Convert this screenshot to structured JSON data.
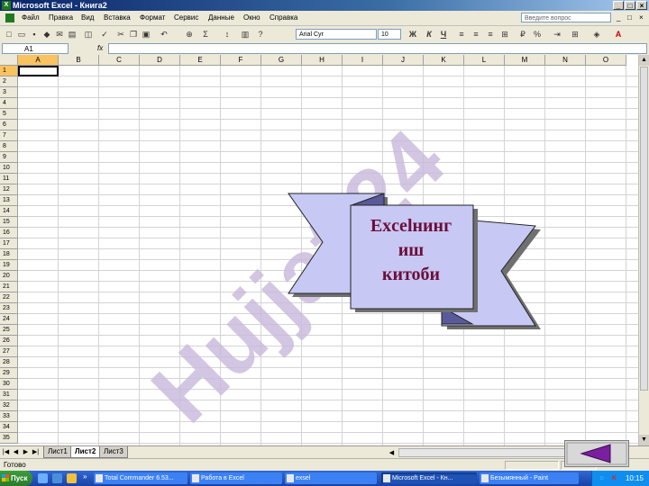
{
  "window": {
    "title": "Microsoft Excel - Книга2",
    "controls": [
      "_",
      "□",
      "×"
    ]
  },
  "menubar": {
    "items": [
      "Файл",
      "Правка",
      "Вид",
      "Вставка",
      "Формат",
      "Сервис",
      "Данные",
      "Окно",
      "Справка"
    ],
    "help_placeholder": "Введите вопрос",
    "doc_controls": [
      "_",
      "□",
      "×"
    ]
  },
  "toolbar": {
    "font": "Arial Cyr",
    "size": "10",
    "bold": "Ж",
    "italic": "К",
    "underline": "Ч",
    "sum": "Σ",
    "percent": "%",
    "zoom_icon": "magnifier-icon"
  },
  "formula_bar": {
    "name_box": "A1",
    "fx": "fx",
    "value": ""
  },
  "grid": {
    "columns": [
      "A",
      "B",
      "C",
      "D",
      "E",
      "F",
      "G",
      "H",
      "I",
      "J",
      "K",
      "L",
      "M",
      "N",
      "O"
    ],
    "rows": [
      "1",
      "2",
      "3",
      "4",
      "5",
      "6",
      "7",
      "8",
      "9",
      "10",
      "11",
      "12",
      "13",
      "14",
      "15",
      "16",
      "17",
      "18",
      "19",
      "20",
      "21",
      "22",
      "23",
      "24",
      "25",
      "26",
      "27",
      "28",
      "29",
      "30",
      "31",
      "32",
      "33",
      "34",
      "35"
    ],
    "selected_cell": "A1"
  },
  "sheets": {
    "tabs": [
      "Лист1",
      "Лист2",
      "Лист3"
    ],
    "active": "Лист2"
  },
  "status": {
    "text": "Готово"
  },
  "banner": {
    "line1": "Excelнинг",
    "line2": "иш",
    "line3": "китоби"
  },
  "watermark": {
    "text": "Hujjat 24"
  },
  "taskbar": {
    "start": "Пуск",
    "tasks": [
      {
        "label": "Total Commander 6.53...",
        "active": false
      },
      {
        "label": "Работа в Excel",
        "active": false
      },
      {
        "label": "exsel",
        "active": false
      },
      {
        "label": "Microsoft Excel - Кн...",
        "active": true
      },
      {
        "label": "Безымянный - Paint",
        "active": false
      }
    ],
    "clock": "10:15",
    "tray_letter": "K"
  },
  "nav_button": {
    "icon": "back-triangle-icon"
  },
  "colors": {
    "banner_fill": "#c8c8f4",
    "banner_text": "#6b0f3a",
    "watermark": "#c8b8dc",
    "selection": "#f9c35f"
  }
}
